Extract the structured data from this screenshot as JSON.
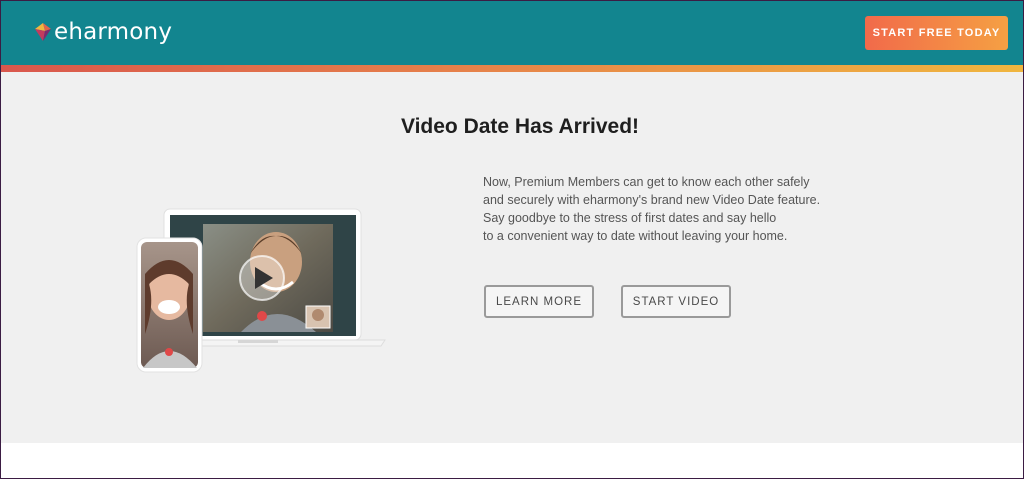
{
  "header": {
    "logo_text": "eharmony",
    "cta_label": "START FREE TODAY"
  },
  "main": {
    "title": "Video Date Has Arrived!",
    "description_lines": [
      "Now, Premium Members can get to know each other safely",
      "and securely with eharmony's brand new Video Date feature.",
      "Say goodbye to the stress of first dates and say hello",
      "to a convenient way to date without leaving your home."
    ],
    "buttons": {
      "learn_more": "LEARN MORE",
      "start_video": "START VIDEO"
    }
  },
  "colors": {
    "header_bg": "#12858f",
    "stripe_start": "#d9574d",
    "stripe_end": "#f0b63f",
    "cta_start": "#f16a4a",
    "cta_end": "#f5a043",
    "page_bg": "#f0f0f0"
  },
  "icons": [
    "eharmony-logo-icon",
    "play-icon",
    "end-call-icon"
  ]
}
